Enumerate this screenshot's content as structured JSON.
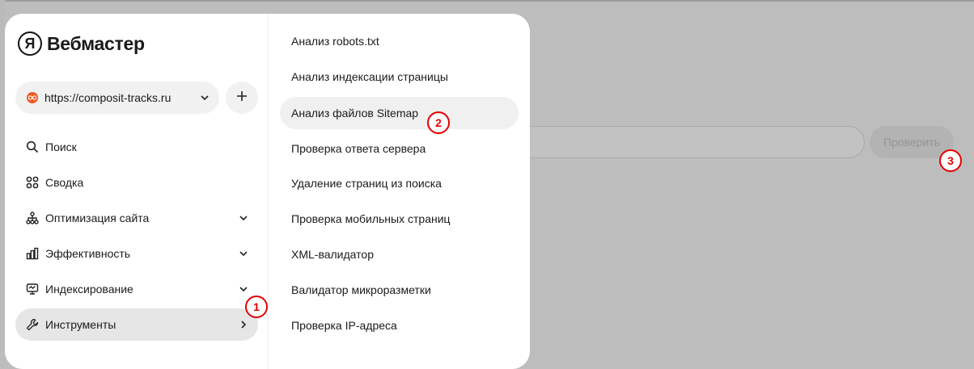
{
  "app": {
    "title": "Вебмастер",
    "logo_letter": "Я"
  },
  "site": {
    "url": "https://composit-tracks.ru"
  },
  "nav": {
    "items": [
      {
        "label": "Поиск",
        "icon": "search-icon"
      },
      {
        "label": "Сводка",
        "icon": "grid-icon"
      },
      {
        "label": "Оптимизация сайта",
        "icon": "sitemap-icon",
        "expandable": true
      },
      {
        "label": "Эффективность",
        "icon": "bar-chart-icon",
        "expandable": true
      },
      {
        "label": "Индексирование",
        "icon": "monitor-icon",
        "expandable": true
      },
      {
        "label": "Инструменты",
        "icon": "wrench-icon",
        "active": true
      }
    ]
  },
  "tools_menu": {
    "items": [
      "Анализ robots.txt",
      "Анализ индексации страницы",
      "Анализ файлов Sitemap",
      "Проверка ответа сервера",
      "Удаление страниц из поиска",
      "Проверка мобильных страниц",
      "XML-валидатор",
      "Валидатор микроразметки",
      "Проверка IP-адреса"
    ],
    "highlighted_index": 2
  },
  "background": {
    "check_button": "Проверить"
  },
  "markers": [
    "1",
    "2",
    "3"
  ],
  "colors": {
    "marker": "#e30000",
    "favicon": "#ee5a24",
    "active_bg": "#e6e6e6"
  }
}
